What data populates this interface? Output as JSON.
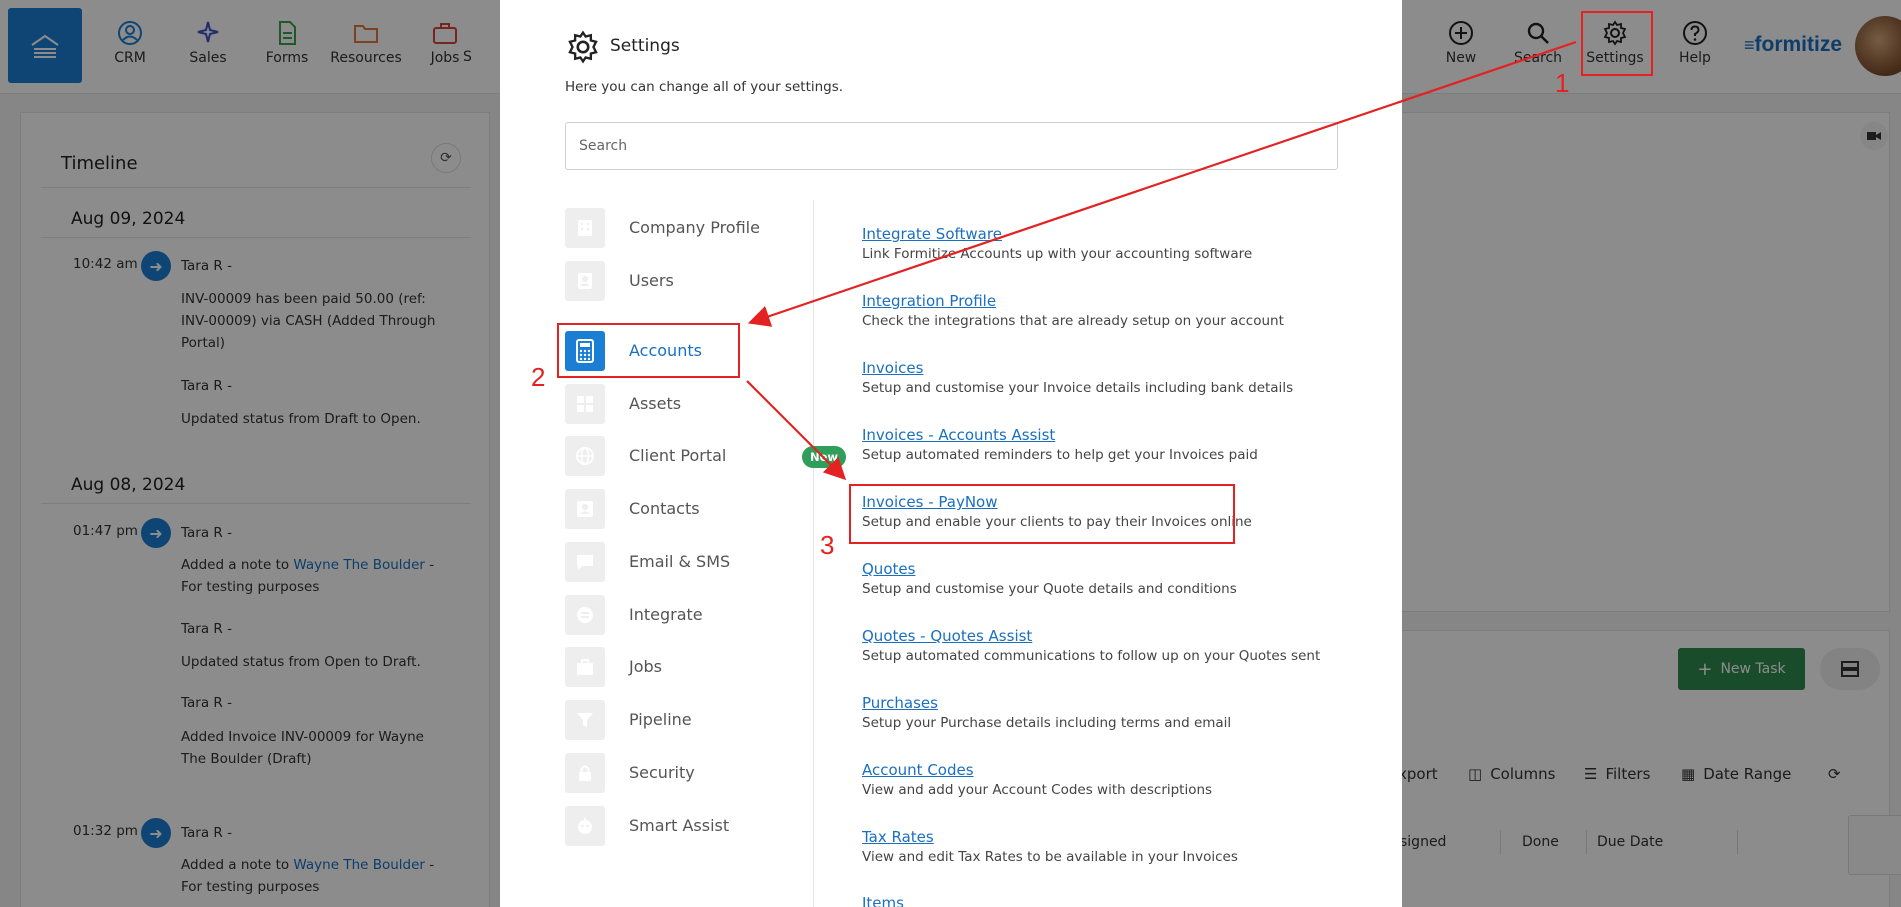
{
  "nav": {
    "items": [
      {
        "label": "CRM",
        "icon": "user-circle-icon",
        "color": "#1a7fd4"
      },
      {
        "label": "Sales",
        "icon": "sparkle-icon",
        "color": "#3a55c9"
      },
      {
        "label": "Forms",
        "icon": "document-icon",
        "color": "#3aa24f"
      },
      {
        "label": "Resources",
        "icon": "folder-icon",
        "color": "#e0793a"
      },
      {
        "label": "Jobs",
        "icon": "briefcase-icon",
        "color": "#d9443a"
      }
    ],
    "partial_label": "S",
    "right_items": [
      {
        "label": "New",
        "icon": "plus-circle-icon"
      },
      {
        "label": "Search",
        "icon": "search-icon"
      },
      {
        "label": "Settings",
        "icon": "gear-icon"
      },
      {
        "label": "Help",
        "icon": "help-circle-icon"
      }
    ],
    "logo": "formitize",
    "brand_color": "#1a7fd4"
  },
  "timeline": {
    "title": "Timeline",
    "groups": [
      {
        "date": "Aug 09, 2024"
      },
      {
        "date": "Aug 08, 2024"
      }
    ],
    "entries": [
      {
        "time": "10:42 am",
        "author": "Tara R -",
        "text": "INV-00009 has been paid 50.00 (ref: INV-00009) via CASH (Added Through Portal)"
      },
      {
        "author": "Tara R -",
        "text": "Updated status from Draft to Open."
      },
      {
        "time": "01:47 pm",
        "author": "Tara R -",
        "text_before": "Added a note to ",
        "link": "Wayne The Boulder",
        "text_after": " - For testing purposes"
      },
      {
        "author": "Tara R -",
        "text": "Updated status from Open to Draft."
      },
      {
        "author": "Tara R -",
        "text": "Added Invoice INV-00009 for Wayne The Boulder (Draft)"
      },
      {
        "time": "01:32 pm",
        "author": "Tara R -",
        "text_before": "Added a note to ",
        "link": "Wayne The Boulder",
        "text_after": " - For testing purposes"
      }
    ]
  },
  "tasks": {
    "new_task_label": "New Task",
    "toolbar": [
      "xport",
      "Columns",
      "Filters",
      "Date Range"
    ],
    "columns": [
      "signed",
      "Done",
      "Due Date"
    ]
  },
  "settings_modal": {
    "title": "Settings",
    "subtitle": "Here you can change all of your settings.",
    "search_placeholder": "Search",
    "sidebar": [
      {
        "label": "Company Profile",
        "icon": "building-icon"
      },
      {
        "label": "Users",
        "icon": "user-icon"
      },
      {
        "label": "Accounts",
        "icon": "calculator-icon",
        "active": true
      },
      {
        "label": "Assets",
        "icon": "assets-icon"
      },
      {
        "label": "Client Portal",
        "icon": "globe-icon",
        "badge": "New"
      },
      {
        "label": "Contacts",
        "icon": "contact-card-icon"
      },
      {
        "label": "Email & SMS",
        "icon": "chat-icon"
      },
      {
        "label": "Integrate",
        "icon": "integrate-icon"
      },
      {
        "label": "Jobs",
        "icon": "briefcase-icon"
      },
      {
        "label": "Pipeline",
        "icon": "funnel-icon"
      },
      {
        "label": "Security",
        "icon": "lock-icon"
      },
      {
        "label": "Smart Assist",
        "icon": "robot-icon"
      }
    ],
    "options": [
      {
        "title": "Integrate Software",
        "desc": "Link Formitize Accounts up with your accounting software"
      },
      {
        "title": "Integration Profile",
        "desc": "Check the integrations that are already setup on your account"
      },
      {
        "title": "Invoices",
        "desc": "Setup and customise your Invoice details including bank details"
      },
      {
        "title": "Invoices - Accounts Assist",
        "desc": "Setup automated reminders to help get your Invoices paid"
      },
      {
        "title": "Invoices - PayNow",
        "desc": "Setup and enable your clients to pay their Invoices online"
      },
      {
        "title": "Quotes",
        "desc": "Setup and customise your Quote details and conditions"
      },
      {
        "title": "Quotes - Quotes Assist",
        "desc": "Setup automated communications to follow up on your Quotes sent"
      },
      {
        "title": "Purchases",
        "desc": "Setup your Purchase details including terms and email"
      },
      {
        "title": "Account Codes",
        "desc": "View and add your Account Codes with descriptions"
      },
      {
        "title": "Tax Rates",
        "desc": "View and edit Tax Rates to be available in your Invoices"
      },
      {
        "title": "Items",
        "desc": ""
      }
    ]
  },
  "annotations": {
    "numbers": [
      "1",
      "2",
      "3"
    ],
    "color": "#e32222"
  }
}
